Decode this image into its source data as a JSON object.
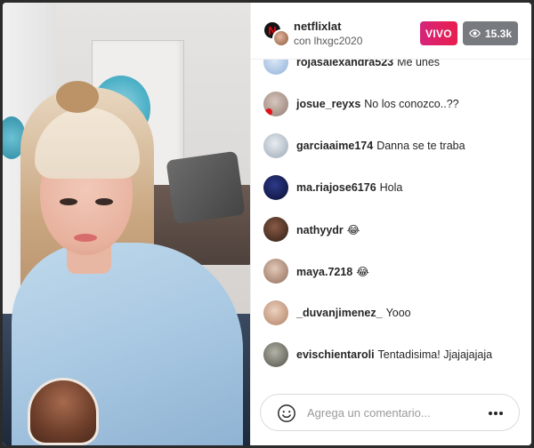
{
  "header": {
    "host_username": "netflixlat",
    "cohost_text": "con lhxgc2020",
    "live_label": "VIVO",
    "viewer_count": "15.3k",
    "viewer_icon": "eye-icon"
  },
  "comments": [
    {
      "username": "rojasalexandra523",
      "text": "Me unes",
      "avatar_color": "#a9c4e6"
    },
    {
      "username": "josue_reyxs",
      "text": "No los conozco..??",
      "avatar_color": "#b7a69c"
    },
    {
      "username": "garciaaime174",
      "text": "Danna se te traba",
      "avatar_color": "#b9c3cf"
    },
    {
      "username": "ma.riajose6176",
      "text": "Hola",
      "avatar_color": "#121a44"
    },
    {
      "username": "nathyydr",
      "text": "😂",
      "avatar_color": "#5a3b2e"
    },
    {
      "username": "maya.7218",
      "text": "😂",
      "avatar_color": "#b68f7a"
    },
    {
      "username": "_duvanjimenez_",
      "text": "Yooo",
      "avatar_color": "#c9a48d"
    },
    {
      "username": "evischientaroli",
      "text": "Tentadisima! Jjajajajaja",
      "avatar_color": "#7a7a6e"
    }
  ],
  "comment_input": {
    "placeholder": "Agrega un comentario...",
    "value": ""
  },
  "icons": {
    "emoji": "smiley-face-icon",
    "more": "more-options-icon"
  },
  "colors": {
    "live_badge": "#e81e4e",
    "viewer_badge": "#777b80",
    "text_primary": "#262626",
    "placeholder": "#9a9a9a"
  }
}
